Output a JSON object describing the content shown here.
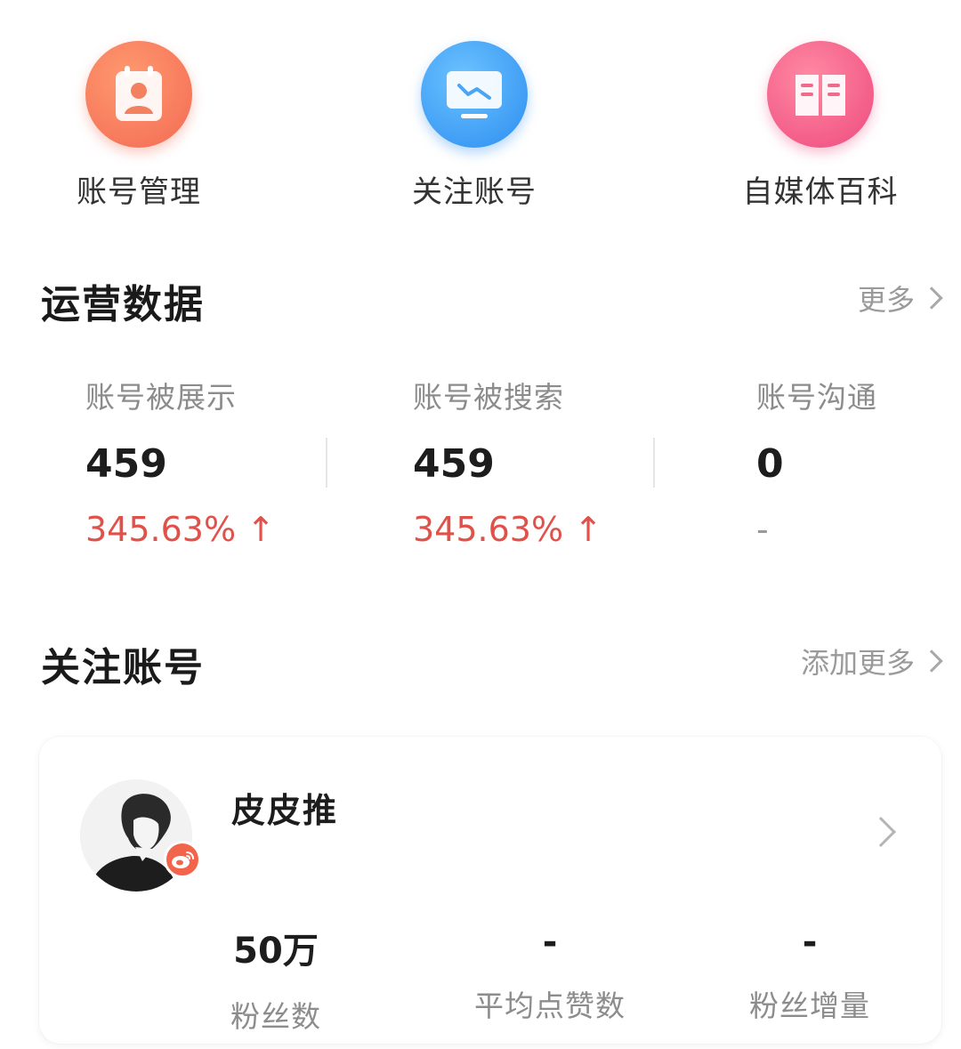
{
  "quick_actions": [
    {
      "label": "账号管理",
      "icon": "contact-card-icon",
      "color": "#f36a54"
    },
    {
      "label": "关注账号",
      "icon": "monitor-trend-icon",
      "color": "#2c8df0"
    },
    {
      "label": "自媒体百科",
      "icon": "open-book-icon",
      "color": "#ee4a7e"
    }
  ],
  "operations": {
    "title": "运营数据",
    "more": "更多",
    "stats": [
      {
        "label": "账号被展示",
        "value": "459",
        "delta": "345.63% ↑"
      },
      {
        "label": "账号被搜索",
        "value": "459",
        "delta": "345.63% ↑"
      },
      {
        "label": "账号沟通",
        "value": "0",
        "delta": "-"
      }
    ]
  },
  "followed": {
    "title": "关注账号",
    "more": "添加更多",
    "account": {
      "name": "皮皮推",
      "platform_icon": "weibo-icon",
      "metrics": [
        {
          "value": "50万",
          "label": "粉丝数"
        },
        {
          "value": "-",
          "label": "平均点赞数"
        },
        {
          "value": "-",
          "label": "粉丝增量"
        }
      ]
    }
  },
  "colors": {
    "up": "#e0514a",
    "muted": "#8c8c8c"
  }
}
